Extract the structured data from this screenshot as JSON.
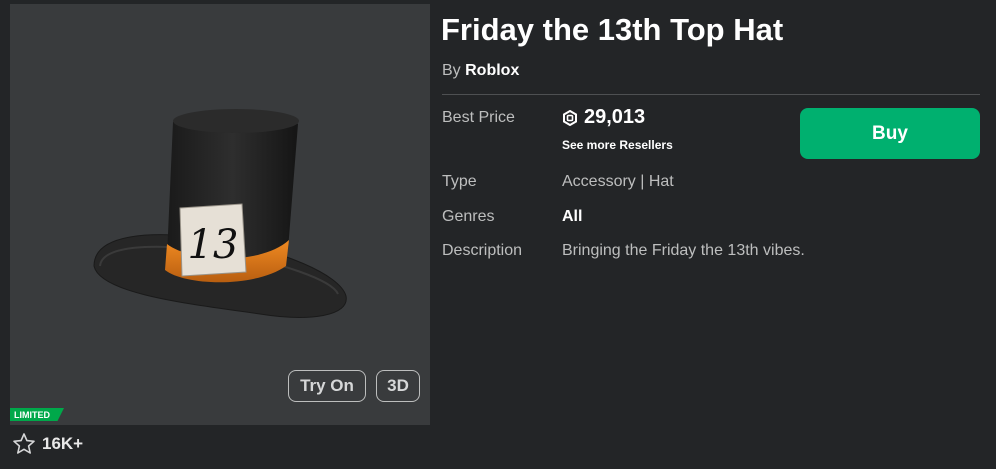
{
  "item": {
    "title": "Friday the 13th Top Hat",
    "by_prefix": "By",
    "creator": "Roblox",
    "badge": "LIMITED",
    "favorites": "16K+",
    "try_on_label": "Try On",
    "three_d_label": "3D"
  },
  "details": {
    "best_price_label": "Best Price",
    "price": "29,013",
    "resellers_link": "See more Resellers",
    "buy_label": "Buy",
    "type_label": "Type",
    "type_value": "Accessory | Hat",
    "genres_label": "Genres",
    "genres_value": "All",
    "description_label": "Description",
    "description_value": "Bringing the Friday the 13th vibes."
  },
  "hat_tag_text": "13",
  "colors": {
    "background": "#232527",
    "thumb_background": "#393b3d",
    "buy_green": "#00b06f",
    "limited_green": "#00a84a",
    "hat_band": "#e07b1c"
  }
}
